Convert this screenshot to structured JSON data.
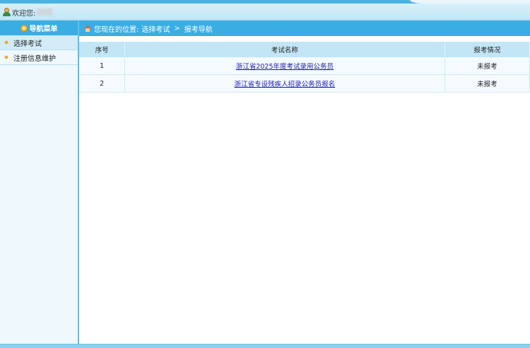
{
  "header": {
    "welcome_label": "欢迎您:"
  },
  "sidebar": {
    "title": "导航菜单",
    "items": [
      {
        "label": "选择考试"
      },
      {
        "label": "注册信息维护"
      }
    ]
  },
  "location": {
    "prefix": "您现在的位置:",
    "level1": "选择考试",
    "separator": ">",
    "level2": "报考导航"
  },
  "table": {
    "headers": [
      "序号",
      "考试名称",
      "报考情况"
    ],
    "rows": [
      {
        "no": "1",
        "name": "浙江省2025年度考试录用公务员",
        "status": "未报考"
      },
      {
        "no": "2",
        "name": "浙江省专设残疾人招录公务员报名",
        "status": "未报考"
      }
    ]
  },
  "colors": {
    "accent": "#3aaee3",
    "header_bg": "#c2e6f6",
    "link": "#1a1ab4"
  }
}
